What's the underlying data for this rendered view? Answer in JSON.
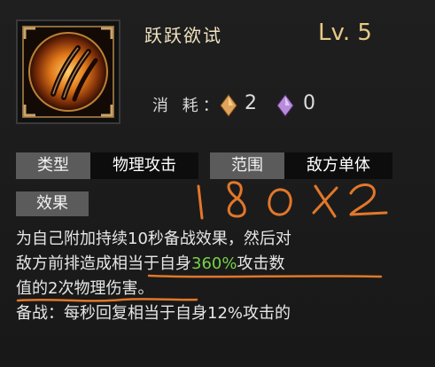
{
  "skill": {
    "name": "跃跃欲试",
    "level": "Lv. 5"
  },
  "cost": {
    "label": "消 耗：",
    "amber": "2",
    "violet": "0",
    "amber_color": "#e0a35a",
    "violet_color": "#b88bdc"
  },
  "tags": {
    "type_label": "类型",
    "type_value": "物理攻击",
    "range_label": "范围",
    "range_value": "敌方单体",
    "effect_label": "效果"
  },
  "description": {
    "line1": "为自己附加持续10秒备战效果，然后对",
    "line2_a": "敌方前排造成相当于自身",
    "line2_pct": "360%",
    "line2_b": "攻击数",
    "line3": "值的2次物理伤害。",
    "line4": "备战：每秒回复相当于自身12%攻击的",
    "highlight_color": "#76d24a"
  },
  "annotation": {
    "handwritten_note": "180X2",
    "ink_color": "#e2772a"
  }
}
